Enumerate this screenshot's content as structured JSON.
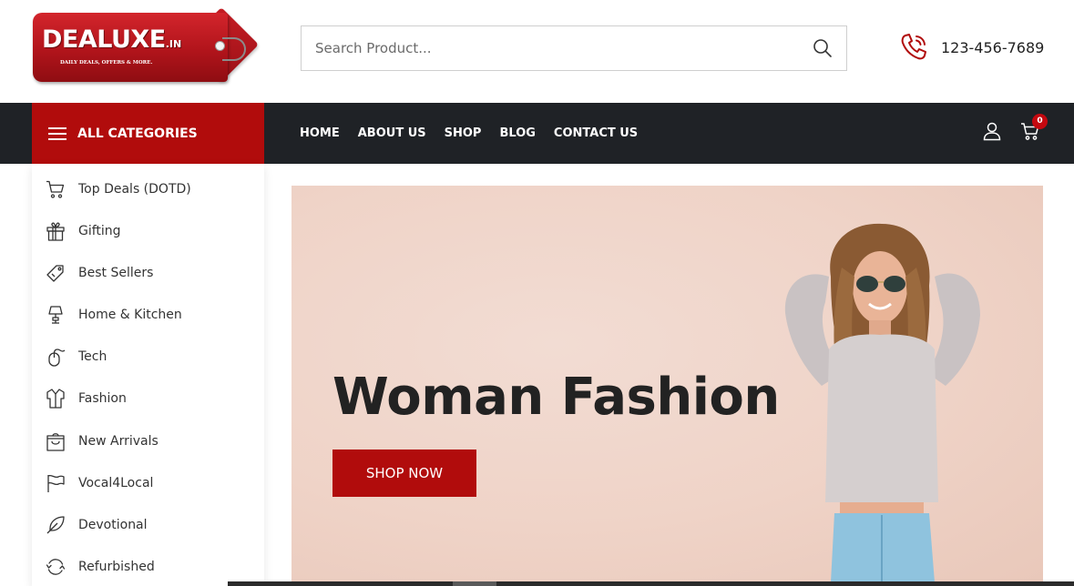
{
  "brand": {
    "logo_text": "DEALUXE",
    "logo_ext": ".IN",
    "logo_tagline": "DAILY DEALS, OFFERS & MORE.",
    "accent_color": "#b10c0c",
    "nav_bg_color": "#1f2226"
  },
  "search": {
    "placeholder": "Search Product...",
    "icon": "search-icon"
  },
  "contact": {
    "phone": "123-456-7689",
    "icon": "phone-icon"
  },
  "nav": {
    "all_categories_label": "ALL CATEGORIES",
    "links": [
      "HOME",
      "ABOUT US",
      "SHOP",
      "BLOG",
      "CONTACT US"
    ],
    "cart_count": "0"
  },
  "categories": [
    {
      "label": "Top Deals (DOTD)",
      "icon": "cart-icon"
    },
    {
      "label": "Gifting",
      "icon": "gift-icon"
    },
    {
      "label": "Best Sellers",
      "icon": "tag-icon"
    },
    {
      "label": "Home & Kitchen",
      "icon": "lamp-icon"
    },
    {
      "label": "Tech",
      "icon": "mouse-icon"
    },
    {
      "label": "Fashion",
      "icon": "shirt-icon"
    },
    {
      "label": "New Arrivals",
      "icon": "shopping-bag-icon"
    },
    {
      "label": "Vocal4Local",
      "icon": "flag-icon"
    },
    {
      "label": "Devotional",
      "icon": "feather-icon"
    },
    {
      "label": "Refurbished",
      "icon": "refresh-icon"
    }
  ],
  "hero": {
    "title": "Woman Fashion",
    "cta_label": "SHOP NOW"
  }
}
